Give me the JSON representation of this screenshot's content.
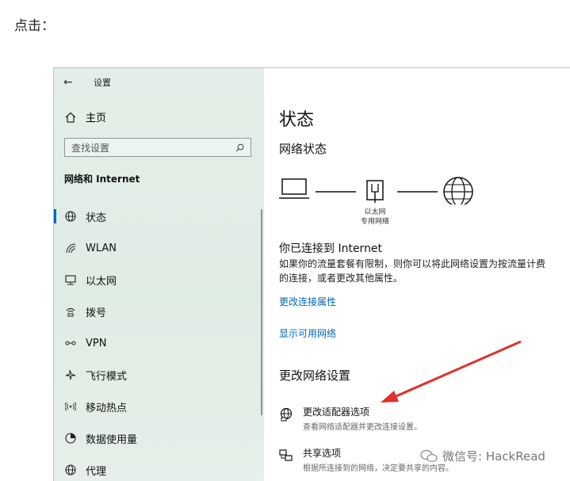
{
  "caption": "点击：",
  "window": {
    "title": "设置",
    "back_glyph": "←"
  },
  "sidebar": {
    "home_label": "主页",
    "search_placeholder": "查找设置",
    "section_title": "网络和 Internet",
    "items": [
      {
        "label": "状态",
        "icon": "globe-icon",
        "active": true
      },
      {
        "label": "WLAN",
        "icon": "wifi-icon"
      },
      {
        "label": "以太网",
        "icon": "ethernet-icon"
      },
      {
        "label": "拨号",
        "icon": "dialup-icon"
      },
      {
        "label": "VPN",
        "icon": "vpn-icon"
      },
      {
        "label": "飞行模式",
        "icon": "airplane-icon"
      },
      {
        "label": "移动热点",
        "icon": "hotspot-icon"
      },
      {
        "label": "数据使用量",
        "icon": "data-usage-icon"
      },
      {
        "label": "代理",
        "icon": "proxy-globe-icon"
      }
    ]
  },
  "main": {
    "page_title": "状态",
    "network_status_heading": "网络状态",
    "diagram": {
      "adapter_label": "以太网",
      "network_label": "专用网络"
    },
    "connected_title": "你已连接到 Internet",
    "connected_desc": "如果你的流量套餐有限制，则你可以将此网络设置为按流量计费的连接，或者更改其他属性。",
    "link_change_props": "更改连接属性",
    "link_show_networks": "显示可用网络",
    "change_settings_heading": "更改网络设置",
    "options": [
      {
        "title": "更改适配器选项",
        "desc": "查看网络适配器并更改连接设置。",
        "icon": "adapter-globe-icon"
      },
      {
        "title": "共享选项",
        "desc": "根据所连接到的网络，决定要共享的内容。",
        "icon": "share-icon"
      }
    ]
  },
  "watermark": "微信号: HackRead",
  "colors": {
    "accent": "#0067b8",
    "arrow": "#e0312d",
    "sidebar_bg": "#e1ede6"
  }
}
